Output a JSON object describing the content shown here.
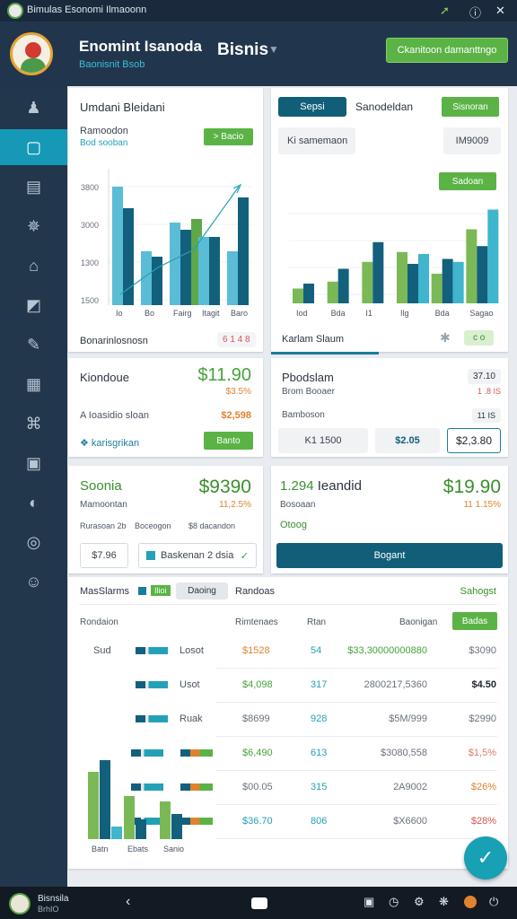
{
  "status_bar": {
    "title": "Bimulas Esonomi Ilmaoonn",
    "icons": [
      "pin-icon",
      "info-icon",
      "close-icon"
    ]
  },
  "header": {
    "brand_title": "Enomint Isanoda",
    "brand_subtitle": "Baonisnit Bsob",
    "business": "Bisnis",
    "cta": "Ckanitoon damanttngo"
  },
  "sidebar": {
    "items": [
      {
        "name": "user",
        "glyph": "♟"
      },
      {
        "name": "dashboard",
        "glyph": "▢",
        "active": true
      },
      {
        "name": "folder",
        "glyph": "▤"
      },
      {
        "name": "settings",
        "glyph": "✵"
      },
      {
        "name": "home",
        "glyph": "⌂"
      },
      {
        "name": "chart",
        "glyph": "◩"
      },
      {
        "name": "edit",
        "glyph": "✎"
      },
      {
        "name": "calendar",
        "glyph": "▦"
      },
      {
        "name": "analytics",
        "glyph": "⌘"
      },
      {
        "name": "puzzle",
        "glyph": "▣"
      },
      {
        "name": "help",
        "glyph": "◐"
      },
      {
        "name": "lock",
        "glyph": "◎"
      },
      {
        "name": "profile",
        "glyph": "☺"
      }
    ]
  },
  "card1": {
    "title": "Umdani Bleidani",
    "subtitle": "Ramoodon",
    "subtitle2": "Bod sooban",
    "button": "> Bacio",
    "footer": "Bonarinlosnosn",
    "footer_badge": "6 1 4 8",
    "chart_data": {
      "type": "bar",
      "categories": [
        "Io",
        "Bo",
        "Fairg",
        "Itagit",
        "Baro"
      ],
      "y_ticks": [
        "3800",
        "3000",
        "1300",
        "1500"
      ],
      "series": [
        {
          "color": "#5bbcd6",
          "values": [
            3300,
            1500,
            2300,
            1900,
            1500
          ]
        },
        {
          "color": "#13607c",
          "values": [
            2700,
            1350,
            2100,
            1900,
            3000
          ]
        },
        {
          "color": "#5ea84a",
          "values": [
            0,
            0,
            2400,
            0,
            0
          ]
        }
      ],
      "trend": true
    }
  },
  "card2": {
    "tab_active": "Sepsi",
    "tab2": "Sanodeldan",
    "tab_button": "Sisnoran",
    "input_label": "Ki samemaon",
    "value_box": "IM9009",
    "button2": "Sadoan",
    "footer": "Karlam Slaum",
    "footer_badge": "c  o",
    "chart_data": {
      "type": "bar",
      "categories": [
        "Iod",
        "Bda",
        "I1",
        "Ilg",
        "Bda",
        "Sagao"
      ],
      "series": [
        {
          "color": "#7ab955",
          "values": [
            15,
            22,
            42,
            52,
            30,
            75
          ]
        },
        {
          "color": "#13607c",
          "values": [
            20,
            35,
            62,
            40,
            45,
            58
          ]
        },
        {
          "color": "#3fb5ce",
          "values": [
            0,
            0,
            0,
            50,
            42,
            95
          ]
        }
      ]
    }
  },
  "card3": {
    "title": "Kiondoue",
    "amount": "$11.90",
    "change": "$3.5%",
    "row_label": "A Ioasidio sloan",
    "row_value": "$2,598",
    "link": "karisgrikan",
    "button": "Banto"
  },
  "card4": {
    "title": "Pbodslam",
    "subtitle": "Brom Booaer",
    "chip1": "37.10",
    "chip2": "1 .8 IS",
    "row_label": "Bamboson",
    "row_chip": "11 IS",
    "input_value": "K1 1500",
    "input_amount": "$2.05",
    "total": "$2,3.80"
  },
  "card5": {
    "title": "Soonia",
    "amount": "$9390",
    "subtitle": "Mamoontan",
    "change": "11,2.5%",
    "label_a": "Rurasoan 2b",
    "label_b": "Boceogon",
    "label_c": "$8 dacandon",
    "value_box": "$7.96",
    "badge_label": "Baskenan 2 dsia"
  },
  "card6": {
    "amount_left": "1.294",
    "title": "Ieandid",
    "amount": "$19.90",
    "subtitle": "Bosoaan",
    "change": "11 1.15%",
    "link": "Otoog",
    "button": "Bogant"
  },
  "table": {
    "title": "MasSlarms",
    "tab_chip": "Ilioi",
    "tab_button": "Daoing",
    "tab_label": "Randoas",
    "action_link": "Sahogst",
    "headers": [
      "Rondaion",
      "Rimtenaes",
      "Rtan",
      "Baonigan",
      "Badas"
    ],
    "rows": [
      {
        "label": "Sud",
        "name": "Losot",
        "price": "$1528",
        "qty": "54",
        "code": "$33,30000000880",
        "total": "$3090",
        "price_color": "#e0822e",
        "qty_color": "#23a1b8",
        "code_color": "#46a33a",
        "total_color": "#6b7280"
      },
      {
        "label": "",
        "name": "Usot",
        "price": "$4,098",
        "qty": "317",
        "code": "2800217,5360",
        "total": "$4.50",
        "price_color": "#46a33a",
        "qty_color": "#23a1b8",
        "code_color": "#6b7280",
        "total_color": "#1c232c"
      },
      {
        "label": "",
        "name": "Ruak",
        "price": "$8699",
        "qty": "928",
        "code": "$5M/999",
        "total": "$2990",
        "price_color": "#6b7280",
        "qty_color": "#23a1b8",
        "code_color": "#6b7280",
        "total_color": "#6b7280"
      },
      {
        "label": "",
        "name": "",
        "price": "$6,490",
        "qty": "613",
        "code": "$3080,558",
        "total": "$1,5%",
        "price_color": "#46a33a",
        "qty_color": "#23a1b8",
        "code_color": "#6b7280",
        "total_color": "#e27a6a"
      },
      {
        "label": "",
        "name": "",
        "price": "$00.05",
        "qty": "315",
        "code": "2A9002",
        "total": "$26%",
        "price_color": "#6b7280",
        "qty_color": "#23a1b8",
        "code_color": "#6b7280",
        "total_color": "#e0822e"
      },
      {
        "label": "",
        "name": "",
        "price": "$36.70",
        "qty": "806",
        "code": "$X6600",
        "total": "$28%",
        "price_color": "#23a1b8",
        "qty_color": "#23a1b8",
        "code_color": "#6b7280",
        "total_color": "#d9544f"
      }
    ],
    "mini_chart": {
      "categories": [
        "Batn",
        "Ebats",
        "Sanio"
      ],
      "series": [
        {
          "color": "#7ab955",
          "values": [
            75,
            48,
            42
          ]
        },
        {
          "color": "#13607c",
          "values": [
            88,
            22,
            28
          ]
        },
        {
          "color": "#3fb5ce",
          "values": [
            14,
            0,
            0
          ]
        }
      ]
    }
  },
  "bottom_bar": {
    "user_name": "Bisnsila",
    "user_sub": "BrhIO"
  },
  "colors": {
    "green": "#5bb346",
    "teal": "#115e79",
    "navy": "#21364d",
    "accent": "#18a0b5"
  }
}
